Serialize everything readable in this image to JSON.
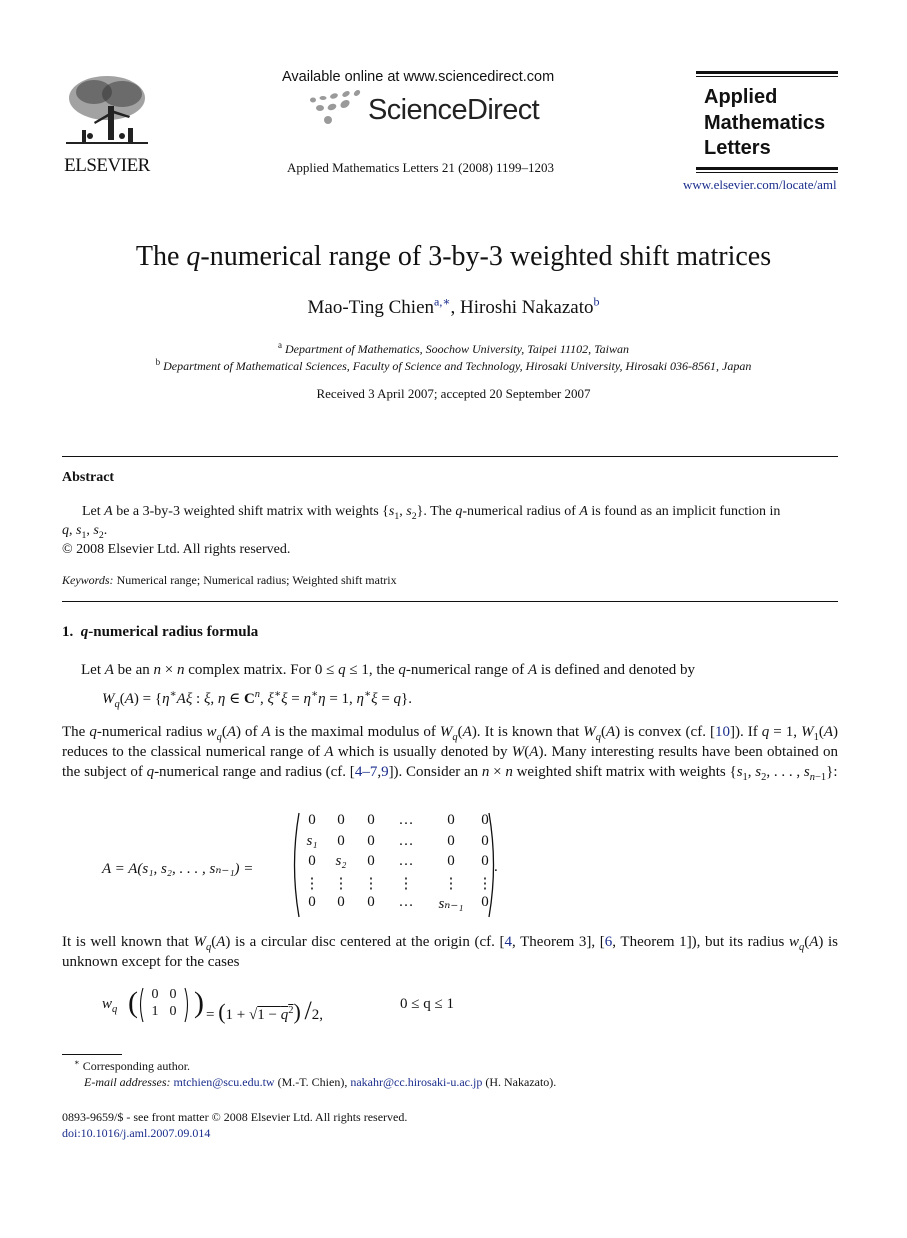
{
  "header": {
    "publisher": "ELSEVIER",
    "available_online": "Available online at www.sciencedirect.com",
    "platform_name": "ScienceDirect",
    "journal_reference": "Applied Mathematics Letters 21 (2008) 1199–1203",
    "journal_title_lines": [
      "Applied",
      "Mathematics",
      "Letters"
    ],
    "journal_url": "www.elsevier.com/locate/aml"
  },
  "article": {
    "title_prefix": "The ",
    "title_var": "q",
    "title_suffix": "-numerical range of 3-by-3 weighted shift matrices",
    "authors": [
      {
        "name": "Mao-Ting Chien",
        "marks": "a,∗"
      },
      {
        "name": "Hiroshi Nakazato",
        "marks": "b"
      }
    ],
    "author_separator": ", ",
    "affiliations": [
      {
        "mark": "a",
        "text": "Department of Mathematics, Soochow University, Taipei 11102, Taiwan"
      },
      {
        "mark": "b",
        "text": "Department of Mathematical Sciences, Faculty of Science and Technology, Hirosaki University, Hirosaki 036-8561, Japan"
      }
    ],
    "received": "Received 3 April 2007; accepted 20 September 2007"
  },
  "abstract": {
    "heading": "Abstract",
    "text_1": "Let ",
    "text_2": " be a 3-by-3 weighted shift matrix with weights {",
    "text_3": "}. The ",
    "text_4": "-numerical radius of ",
    "text_5": " is found as an implicit function in",
    "line2": "q, s₁, s₂.",
    "copyright": "© 2008 Elsevier Ltd. All rights reserved.",
    "keywords_label": "Keywords:",
    "keywords": "Numerical range; Numerical radius; Weighted shift matrix"
  },
  "section1": {
    "heading_number": "1.",
    "heading_var": "q",
    "heading_text": "-numerical radius formula",
    "intro": "complex matrix. For 0 ≤ q ≤ 1, the q-numerical range of A is defined and denoted by",
    "definition_eq": "W_q(A) = {η*Aξ : ξ, η ∈ Cⁿ, ξ*ξ = η*η = 1, η*ξ = q}.",
    "paragraph_refs": {
      "convex": "10",
      "range": "4–7",
      "range2": "9"
    },
    "known_refs": [
      {
        "num": "4",
        "note": "Theorem 3"
      },
      {
        "num": "6",
        "note": "Theorem 1"
      }
    ],
    "matrix": {
      "lhs": "A = A(s₁, s₂, . . . , sₙ₋₁) =",
      "rows": [
        [
          "0",
          "0",
          "0",
          "…",
          "0",
          "0"
        ],
        [
          "s₁",
          "0",
          "0",
          "…",
          "0",
          "0"
        ],
        [
          "0",
          "s₂",
          "0",
          "…",
          "0",
          "0"
        ],
        [
          "⋮",
          "⋮",
          "⋮",
          "⋮",
          "⋮",
          "⋮"
        ],
        [
          "0",
          "0",
          "0",
          "…",
          "sₙ₋₁",
          "0"
        ]
      ]
    },
    "formula_wq2": {
      "lhs": "w",
      "lhs_sub": "q",
      "matrix": [
        [
          "0",
          "0"
        ],
        [
          "1",
          "0"
        ]
      ],
      "rhs": "= (1 + √(1 − q²)) / 2,",
      "range": "0 ≤ q ≤ 1"
    }
  },
  "footnotes": {
    "corresponding": "Corresponding author.",
    "email_label": "E-mail addresses:",
    "emails": [
      {
        "address": "mtchien@scu.edu.tw",
        "owner": "(M.-T. Chien)"
      },
      {
        "address": "nakahr@cc.hirosaki-u.ac.jp",
        "owner": "(H. Nakazato)."
      }
    ],
    "issn_line": "0893-9659/$ - see front matter © 2008 Elsevier Ltd. All rights reserved.",
    "doi": "doi:10.1016/j.aml.2007.09.014"
  },
  "colors": {
    "link": "#1a2d8c",
    "text": "#111111"
  }
}
